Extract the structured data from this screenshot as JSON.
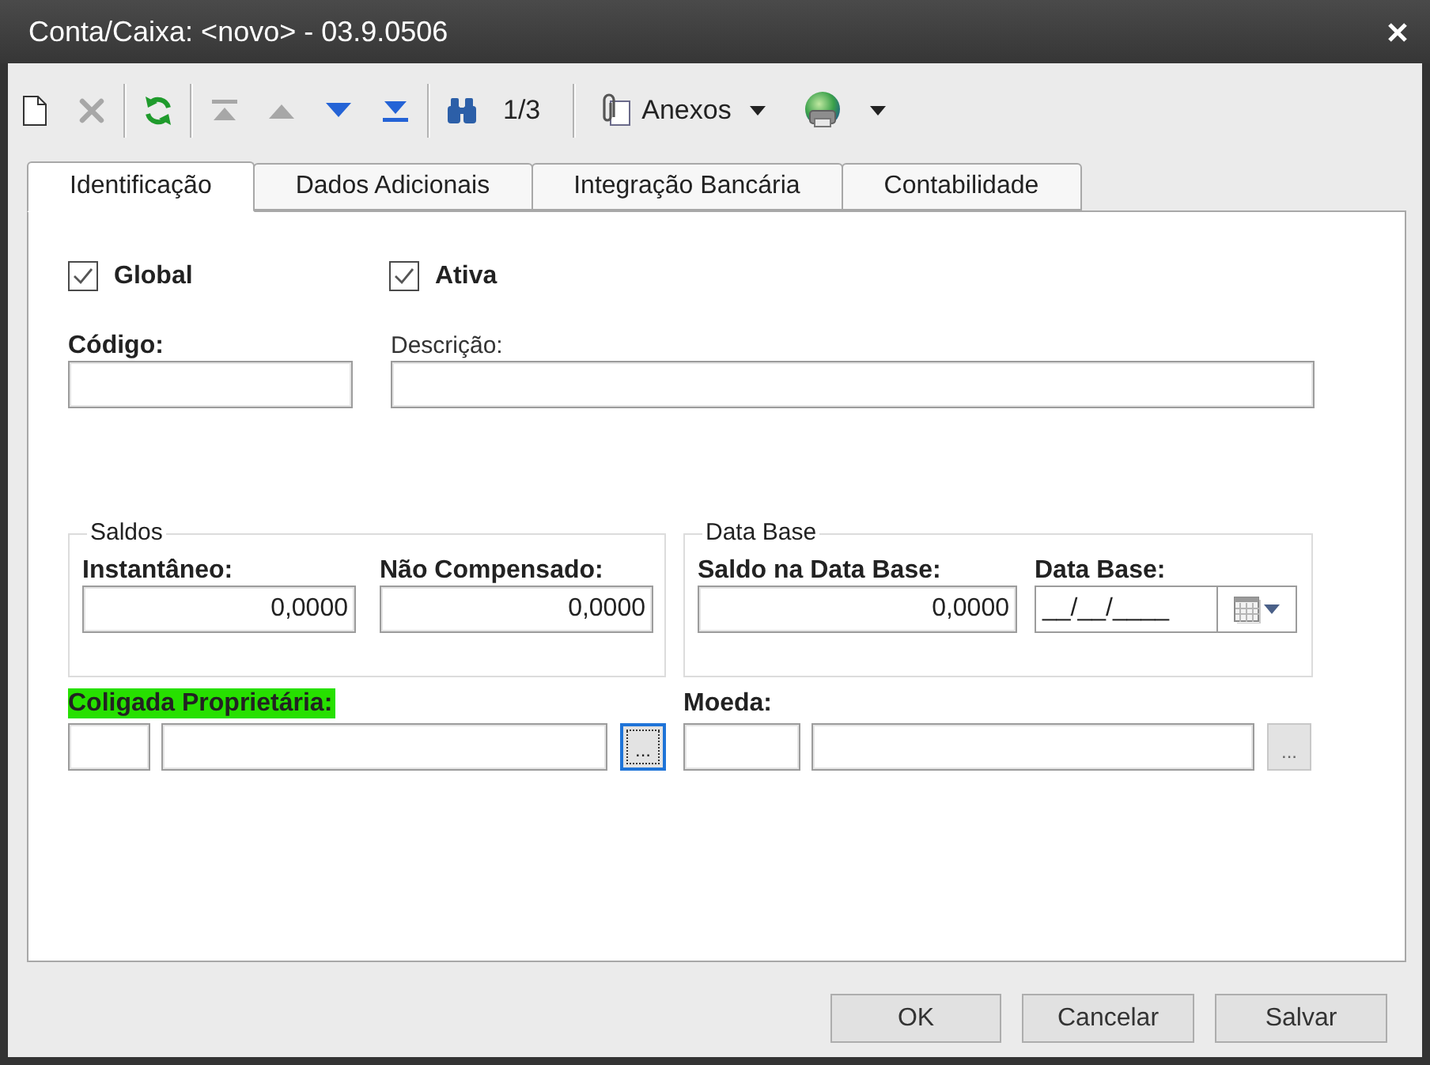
{
  "window": {
    "title": "Conta/Caixa: <novo> - 03.9.0506"
  },
  "toolbar": {
    "buttons": [
      {
        "disabled": false
      },
      {
        "disabled": true
      },
      {
        "disabled": false
      },
      {
        "disabled": true
      },
      {
        "disabled": true
      },
      {
        "disabled": false
      },
      {
        "disabled": false
      },
      {
        "disabled": false
      }
    ],
    "record_counter": "1/3",
    "attachments": "Anexos"
  },
  "tabs": [
    {
      "label": "Identificação",
      "selected": true
    },
    {
      "label": "Dados Adicionais",
      "selected": false
    },
    {
      "label": "Integração Bancária",
      "selected": false
    },
    {
      "label": "Contabilidade",
      "selected": false
    }
  ],
  "checkboxes": [
    {
      "label": "Global",
      "checked": true
    },
    {
      "label": "Ativa",
      "checked": true
    }
  ],
  "text_fields": [
    {
      "label": "Código:",
      "required": true
    },
    {
      "label": "Descrição:",
      "required": false
    }
  ],
  "groups": [
    {
      "title": "Saldos",
      "fields": [
        {
          "kind": "number",
          "label": "Instantâneo:",
          "required": true,
          "value": "0,0000"
        },
        {
          "kind": "number",
          "label": "Não Compensado:",
          "required": true,
          "value": "0,0000"
        }
      ]
    },
    {
      "title": "Data Base",
      "fields": [
        {
          "kind": "number",
          "label": "Saldo na Data Base:",
          "required": true,
          "value": "0,0000"
        },
        {
          "kind": "date",
          "label": "Data Base:",
          "required": true,
          "value": "__/__/____"
        }
      ]
    }
  ],
  "lookups": [
    {
      "label": "Coligada Proprietária:",
      "required": true,
      "highlighted": true,
      "button": "...",
      "focused": true
    },
    {
      "label": "Moeda:",
      "required": true,
      "highlighted": false,
      "button": "...",
      "focused": false
    }
  ],
  "buttons": [
    "OK",
    "Cancelar",
    "Salvar"
  ]
}
